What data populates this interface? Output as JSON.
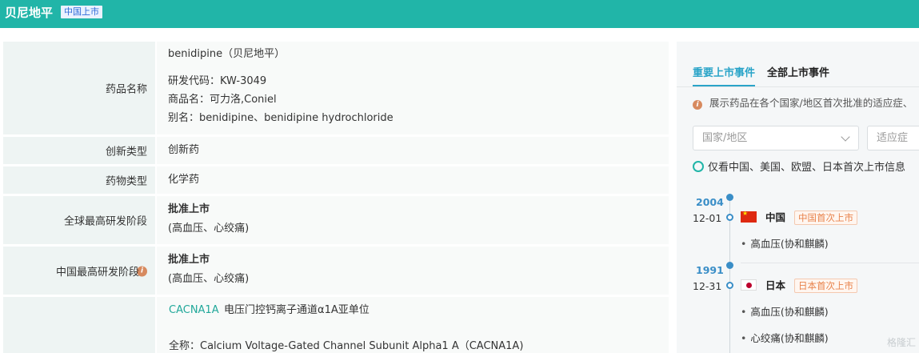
{
  "header": {
    "title": "贝尼地平",
    "tag": "中国上市"
  },
  "details": {
    "drug_name": {
      "label": "药品名称",
      "primary": "benidipine（贝尼地平）",
      "code": "研发代码：KW-3049",
      "trade_name": "商品名：可力洛,Coniel",
      "alias": "别名：benidipine、benidipine hydrochloride"
    },
    "innovation_type": {
      "label": "创新类型",
      "value": "创新药"
    },
    "drug_type": {
      "label": "药物类型",
      "value": "化学药"
    },
    "global_stage": {
      "label": "全球最高研发阶段",
      "value": "批准上市",
      "sub": "(高血压、心绞痛)"
    },
    "china_stage": {
      "label": "中国最高研发阶段",
      "value": "批准上市",
      "sub": "(高血压、心绞痛)",
      "info_icon": "info-icon"
    },
    "target": {
      "gene": "CACNA1A",
      "desc": "电压门控钙离子通道α1A亚单位",
      "full_name": "全称：Calcium Voltage-Gated Channel Subunit Alpha1 A（CACNA1A)"
    }
  },
  "events": {
    "tabs": [
      "重要上市事件",
      "全部上市事件"
    ],
    "active_tab": 0,
    "note": "展示药品在各个国家/地区首次批准的适应症、",
    "filters": {
      "country_placeholder": "国家/地区",
      "indication_placeholder": "适应症"
    },
    "checkbox_label": "仅看中国、美国、欧盟、日本首次上市信息",
    "timeline": [
      {
        "year": "2004",
        "date": "12-01",
        "country": "中国",
        "flag": "cn-flag",
        "badge": "中国首次上市",
        "indications": [
          "高血压(协和麒麟)"
        ]
      },
      {
        "year": "1991",
        "date": "12-31",
        "country": "日本",
        "flag": "jp-flag",
        "badge": "日本首次上市",
        "indications": [
          "高血压(协和麒麟)",
          "心绞痛(协和麒麟)"
        ]
      }
    ]
  },
  "watermark": "格隆汇",
  "colors": {
    "header_bg": "#21b5a8",
    "accent": "#2aa4c8",
    "timeline": "#3a8ec7",
    "badge": "#e8834c"
  }
}
